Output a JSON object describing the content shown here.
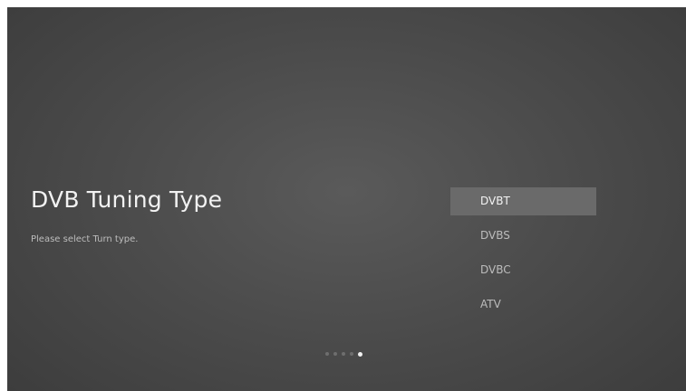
{
  "screen": {
    "title": "DVB Tuning Type",
    "subtitle": "Please select Turn type."
  },
  "options": [
    {
      "label": "DVBT",
      "selected": true
    },
    {
      "label": "DVBS",
      "selected": false
    },
    {
      "label": "DVBC",
      "selected": false
    },
    {
      "label": "ATV",
      "selected": false
    }
  ],
  "pager": {
    "total_steps": 5,
    "current_step": 5
  },
  "colors": {
    "selected_highlight": "#6a6a6a",
    "active_dot": "#f2f2f2",
    "inactive_dot": "#6e6e6e"
  }
}
